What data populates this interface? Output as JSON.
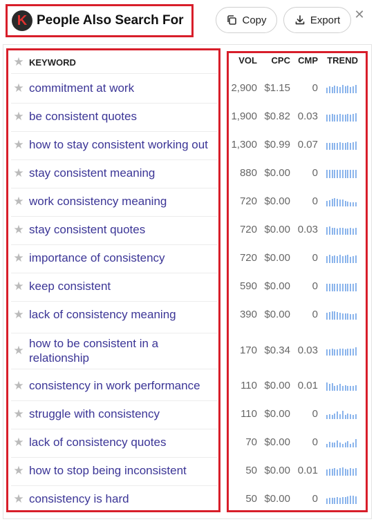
{
  "header": {
    "logo_letter": "K",
    "title": "People Also Search For",
    "copy_label": "Copy",
    "export_label": "Export",
    "close_glyph": "✕"
  },
  "table": {
    "columns": {
      "keyword": "KEYWORD",
      "vol": "VOL",
      "cpc": "CPC",
      "cmp": "CMP",
      "trend": "TREND"
    },
    "rows": [
      {
        "keyword": "commitment at work",
        "vol": "2,900",
        "cpc": "$1.15",
        "cmp": "0",
        "trend": [
          8,
          10,
          9,
          11,
          10,
          9,
          12,
          10,
          11,
          9,
          10,
          12
        ]
      },
      {
        "keyword": "be consistent quotes",
        "vol": "1,900",
        "cpc": "$0.82",
        "cmp": "0.03",
        "trend": [
          9,
          9,
          10,
          9,
          9,
          10,
          9,
          9,
          10,
          9,
          10,
          11
        ]
      },
      {
        "keyword": "how to stay consistent working out",
        "vol": "1,300",
        "cpc": "$0.99",
        "cmp": "0.07",
        "trend": [
          9,
          9,
          9,
          9,
          9,
          10,
          9,
          9,
          10,
          9,
          10,
          11
        ]
      },
      {
        "keyword": "stay consistent meaning",
        "vol": "880",
        "cpc": "$0.00",
        "cmp": "0",
        "trend": [
          10,
          10,
          10,
          10,
          10,
          10,
          10,
          10,
          10,
          10,
          10,
          10
        ]
      },
      {
        "keyword": "work consistency meaning",
        "vol": "720",
        "cpc": "$0.00",
        "cmp": "0",
        "trend": [
          8,
          9,
          11,
          12,
          11,
          10,
          10,
          8,
          7,
          6,
          6,
          6
        ]
      },
      {
        "keyword": "stay consistent quotes",
        "vol": "720",
        "cpc": "$0.00",
        "cmp": "0.03",
        "trend": [
          11,
          12,
          10,
          10,
          9,
          10,
          10,
          9,
          9,
          10,
          9,
          10
        ]
      },
      {
        "keyword": "importance of consistency",
        "vol": "720",
        "cpc": "$0.00",
        "cmp": "0",
        "trend": [
          10,
          12,
          10,
          11,
          10,
          12,
          10,
          11,
          12,
          9,
          10,
          11
        ]
      },
      {
        "keyword": "keep consistent",
        "vol": "590",
        "cpc": "$0.00",
        "cmp": "0",
        "trend": [
          10,
          10,
          10,
          10,
          10,
          10,
          10,
          10,
          10,
          10,
          10,
          11
        ]
      },
      {
        "keyword": "lack of consistency meaning",
        "vol": "390",
        "cpc": "$0.00",
        "cmp": "0",
        "trend": [
          9,
          10,
          11,
          11,
          10,
          9,
          8,
          8,
          8,
          7,
          7,
          8
        ]
      },
      {
        "keyword": "how to be consistent in a relationship",
        "vol": "170",
        "cpc": "$0.34",
        "cmp": "0.03",
        "trend": [
          9,
          9,
          10,
          9,
          9,
          10,
          10,
          9,
          10,
          10,
          10,
          12
        ]
      },
      {
        "keyword": "consistency in work performance",
        "vol": "110",
        "cpc": "$0.00",
        "cmp": "0.01",
        "trend": [
          10,
          8,
          9,
          6,
          7,
          8,
          6,
          7,
          6,
          6,
          6,
          7
        ]
      },
      {
        "keyword": "struggle with consistency",
        "vol": "110",
        "cpc": "$0.00",
        "cmp": "0",
        "trend": [
          5,
          6,
          5,
          7,
          9,
          6,
          10,
          5,
          7,
          6,
          5,
          6
        ]
      },
      {
        "keyword": "lack of consistency quotes",
        "vol": "70",
        "cpc": "$0.00",
        "cmp": "0",
        "trend": [
          5,
          7,
          6,
          6,
          9,
          6,
          5,
          6,
          8,
          5,
          6,
          11
        ]
      },
      {
        "keyword": "how to stop being inconsistent",
        "vol": "50",
        "cpc": "$0.00",
        "cmp": "0.01",
        "trend": [
          8,
          9,
          9,
          10,
          8,
          10,
          11,
          9,
          8,
          10,
          9,
          10
        ]
      },
      {
        "keyword": "consistency is hard",
        "vol": "50",
        "cpc": "$0.00",
        "cmp": "0",
        "trend": [
          8,
          9,
          9,
          9,
          10,
          9,
          10,
          10,
          11,
          12,
          12,
          11
        ]
      }
    ]
  },
  "colors": {
    "highlight": "#d81e2a",
    "keyword_link": "#3b3596",
    "trend_bar": "#8ab4ec"
  }
}
